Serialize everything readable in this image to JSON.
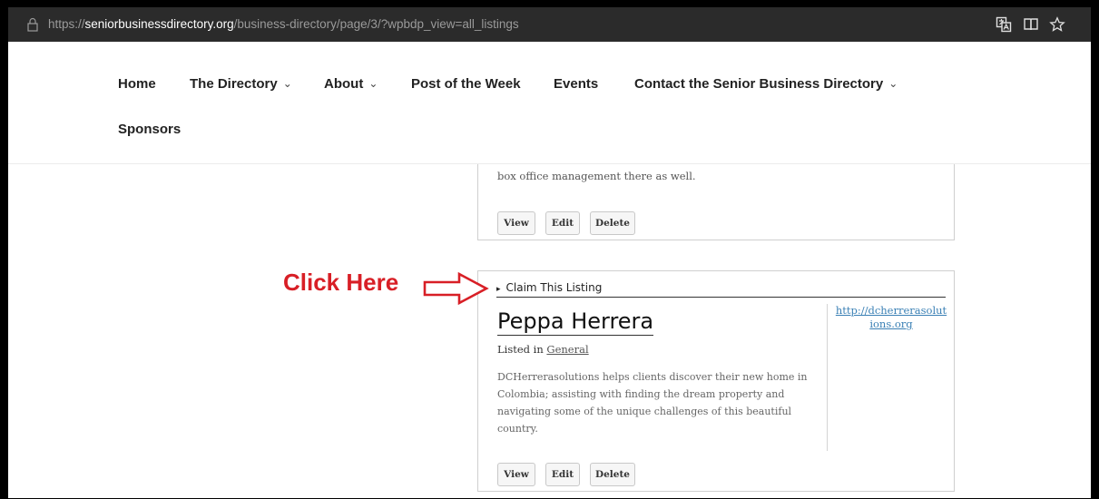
{
  "browser": {
    "url_prefix": "https://",
    "url_host": "seniorbusinessdirectory.org",
    "url_path": "/business-directory/page/3/?wpbdp_view=all_listings",
    "icons": [
      "lock-icon",
      "extension-icon",
      "reading-view-icon",
      "favorite-star-icon"
    ]
  },
  "nav": {
    "items": [
      {
        "label": "Home",
        "dropdown": false
      },
      {
        "label": "The Directory",
        "dropdown": true
      },
      {
        "label": "About",
        "dropdown": true
      },
      {
        "label": "Post of the Week",
        "dropdown": false
      },
      {
        "label": "Events",
        "dropdown": false
      },
      {
        "label": "Contact the Senior Business Directory",
        "dropdown": true
      },
      {
        "label": "Sponsors",
        "dropdown": false
      }
    ],
    "chevron": "⌄"
  },
  "prev_listing": {
    "excerpt_tail": "box office management there as well.",
    "buttons": {
      "view": "View",
      "edit": "Edit",
      "delete": "Delete"
    }
  },
  "listing": {
    "claim_marker": "▸",
    "claim_label": "Claim This Listing",
    "title": "Peppa Herrera",
    "listed_in_prefix": "Listed in",
    "category": "General",
    "description_lines": [
      "DCHerrerasolutions helps clients discover their new home in",
      "Colombia; assisting with finding the dream property and",
      "navigating some of the unique challenges of this beautiful",
      "country."
    ],
    "website_lines": [
      "http://dcherrerasolut",
      "ions.org"
    ],
    "buttons": {
      "view": "View",
      "edit": "Edit",
      "delete": "Delete"
    }
  },
  "annotation": {
    "label": "Click Here",
    "color": "#d81f26"
  }
}
